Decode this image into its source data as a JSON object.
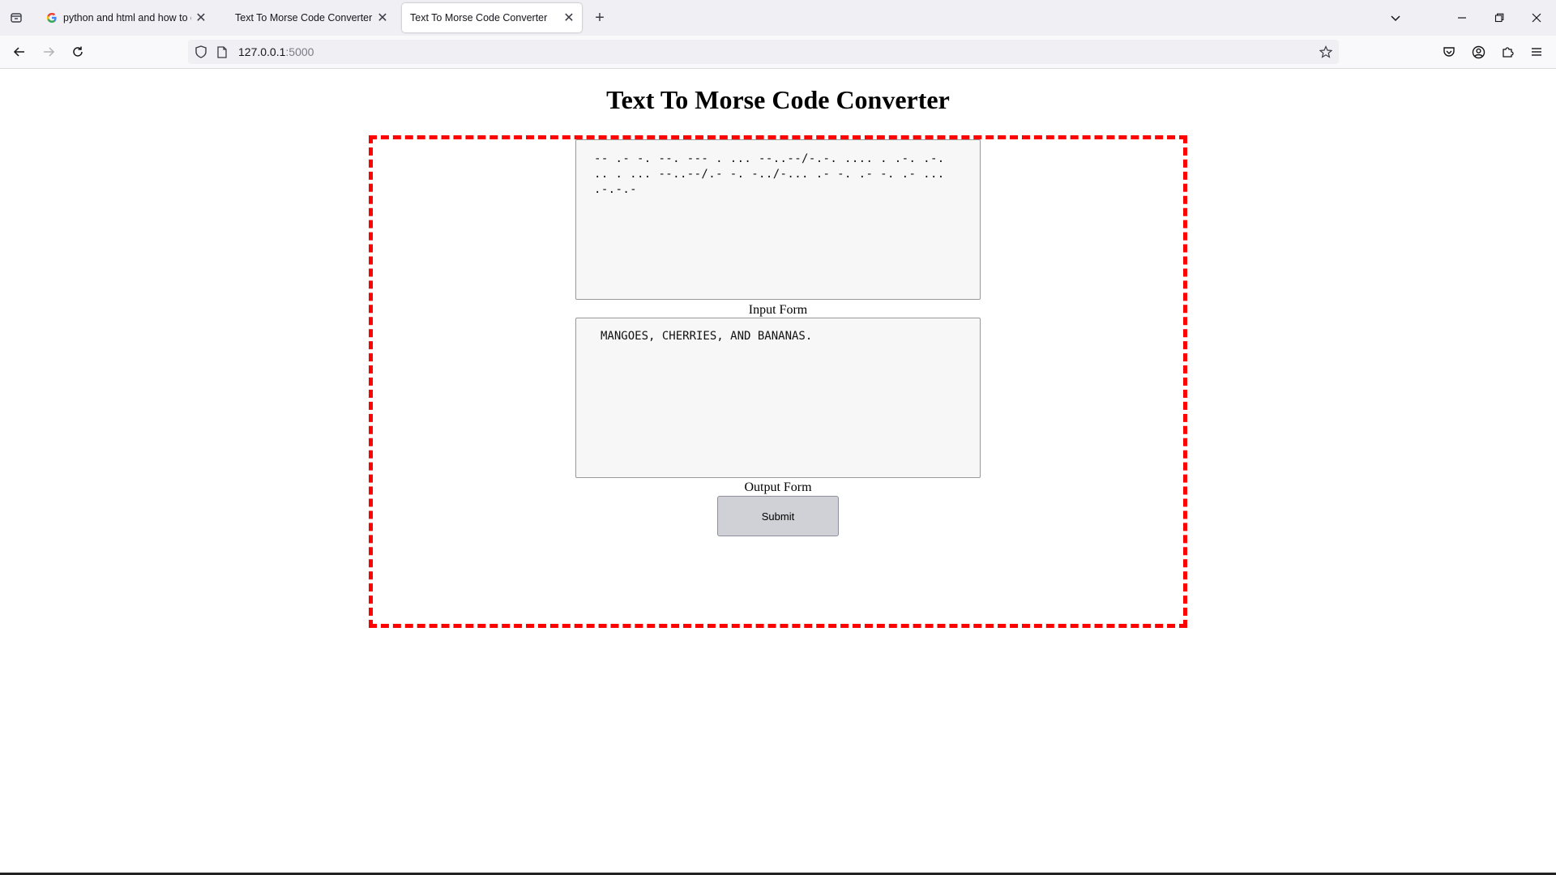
{
  "browser": {
    "tabs": [
      {
        "title": "python and html and how to en",
        "favicon": "google-g-icon",
        "active": false
      },
      {
        "title": "Text To Morse Code Converter",
        "active": false
      },
      {
        "title": "Text To Morse Code Converter",
        "active": true
      }
    ],
    "url_host": "127.0.0.1",
    "url_port": ":5000"
  },
  "page": {
    "heading": "Text To Morse Code Converter",
    "input_value": "-- .- -. --. --- . ... --..--/-.-. .... . .-. .-. .. . ... --..--/.- -. -../-... .- -. .- -. .- ... .-.-.-",
    "input_label": "Input Form",
    "output_value": "MANGOES, CHERRIES, AND BANANAS.",
    "output_label": "Output Form",
    "submit_label": "Submit"
  },
  "colors": {
    "frame_border": "#ff0000",
    "textarea_bg": "#f7f7f7",
    "button_bg": "#d0d0d7"
  }
}
